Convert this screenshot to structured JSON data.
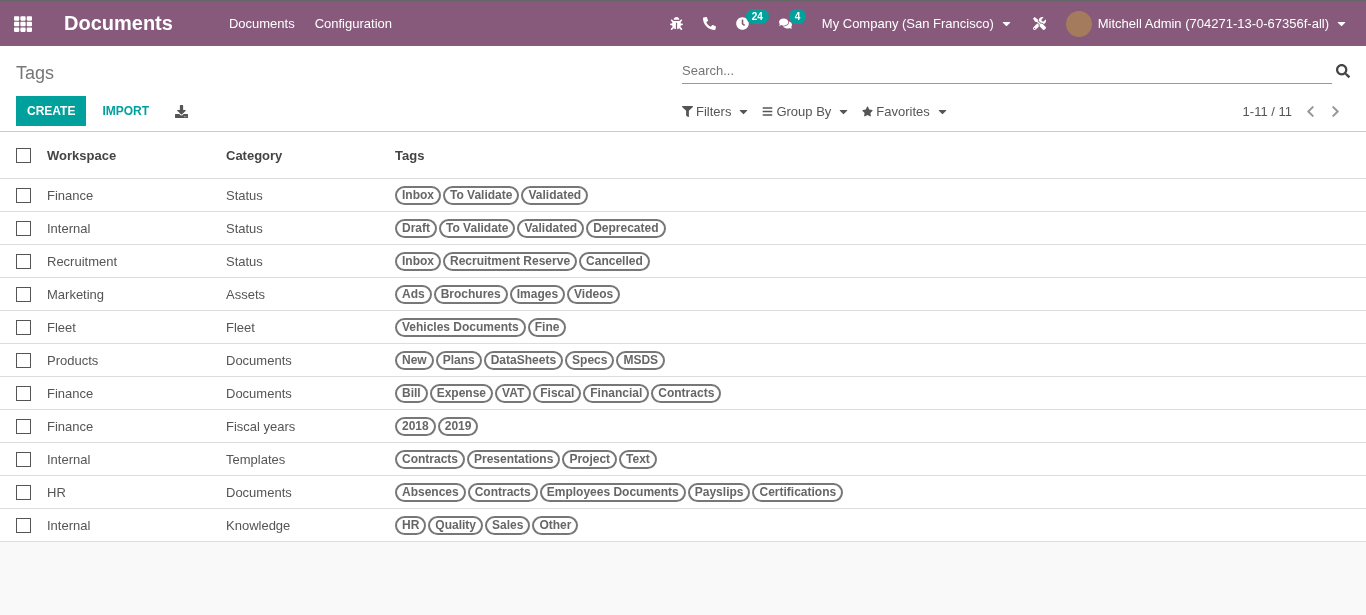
{
  "navbar": {
    "app_title": "Documents",
    "menu": [
      "Documents",
      "Configuration"
    ],
    "activity_count": "24",
    "message_count": "4",
    "company": "My Company (San Francisco)",
    "user": "Mitchell Admin (704271-13-0-67356f-all)"
  },
  "breadcrumb": "Tags",
  "buttons": {
    "create": "CREATE",
    "import": "IMPORT"
  },
  "search": {
    "placeholder": "Search..."
  },
  "filters": [
    "Filters",
    "Group By",
    "Favorites"
  ],
  "pager": "1-11 / 11",
  "table": {
    "columns": [
      "Workspace",
      "Category",
      "Tags"
    ],
    "all_checked": false,
    "rows": [
      {
        "checked": false,
        "workspace": "Finance",
        "category": "Status",
        "tags": [
          "Inbox",
          "To Validate",
          "Validated"
        ]
      },
      {
        "checked": false,
        "workspace": "Internal",
        "category": "Status",
        "tags": [
          "Draft",
          "To Validate",
          "Validated",
          "Deprecated"
        ]
      },
      {
        "checked": false,
        "workspace": "Recruitment",
        "category": "Status",
        "tags": [
          "Inbox",
          "Recruitment Reserve",
          "Cancelled"
        ]
      },
      {
        "checked": false,
        "workspace": "Marketing",
        "category": "Assets",
        "tags": [
          "Ads",
          "Brochures",
          "Images",
          "Videos"
        ]
      },
      {
        "checked": false,
        "workspace": "Fleet",
        "category": "Fleet",
        "tags": [
          "Vehicles Documents",
          "Fine"
        ]
      },
      {
        "checked": false,
        "workspace": "Products",
        "category": "Documents",
        "tags": [
          "New",
          "Plans",
          "DataSheets",
          "Specs",
          "MSDS"
        ]
      },
      {
        "checked": false,
        "workspace": "Finance",
        "category": "Documents",
        "tags": [
          "Bill",
          "Expense",
          "VAT",
          "Fiscal",
          "Financial",
          "Contracts"
        ]
      },
      {
        "checked": false,
        "workspace": "Finance",
        "category": "Fiscal years",
        "tags": [
          "2018",
          "2019"
        ]
      },
      {
        "checked": false,
        "workspace": "Internal",
        "category": "Templates",
        "tags": [
          "Contracts",
          "Presentations",
          "Project",
          "Text"
        ]
      },
      {
        "checked": false,
        "workspace": "HR",
        "category": "Documents",
        "tags": [
          "Absences",
          "Contracts",
          "Employees Documents",
          "Payslips",
          "Certifications"
        ]
      },
      {
        "checked": false,
        "workspace": "Internal",
        "category": "Knowledge",
        "tags": [
          "HR",
          "Quality",
          "Sales",
          "Other"
        ]
      }
    ]
  }
}
